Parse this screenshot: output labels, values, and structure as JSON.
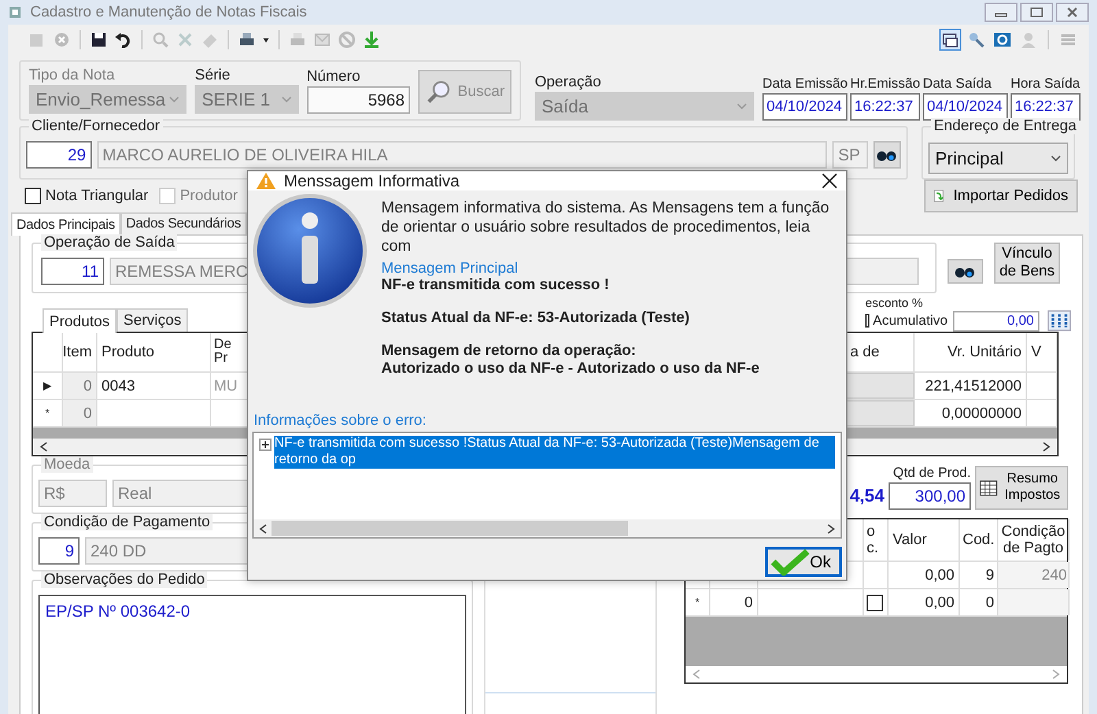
{
  "window": {
    "title": "Cadastro e Manutenção de Notas Fiscais"
  },
  "nota": {
    "tipo": {
      "label": "Tipo da Nota",
      "value": "Envio_Remessa",
      "disabled": true
    },
    "serie": {
      "label": "Série",
      "value": "SERIE 1",
      "disabled": true
    },
    "numero": {
      "label": "Número",
      "value": "5968"
    },
    "buscar": {
      "label": "Buscar",
      "disabled": true
    },
    "operacao": {
      "label": "Operação",
      "value": "Saída",
      "disabled": true
    }
  },
  "datas": [
    {
      "label": "Data Emissão",
      "value": "04/10/2024"
    },
    {
      "label": "Hr.Emissão",
      "value": "16:22:37"
    },
    {
      "label": "Data Saída",
      "value": "04/10/2024"
    },
    {
      "label": "Hora Saída",
      "value": "16:22:37"
    }
  ],
  "cliente": {
    "label": "Cliente/Fornecedor",
    "code": "29",
    "name": "MARCO AURELIO DE OLIVEIRA HILA",
    "uf": "SP"
  },
  "endereco": {
    "label": "Endereço de Entrega",
    "value": "Principal"
  },
  "options": [
    {
      "label": "Nota Triangular",
      "checked": false,
      "disabled": false
    },
    {
      "label": "Produtor",
      "checked": false,
      "disabled": true
    }
  ],
  "import_button": "Importar Pedidos",
  "tabs": [
    {
      "label": "Dados Principais",
      "selected": true
    },
    {
      "label": "Dados Secundários",
      "selected": false
    }
  ],
  "operacao_saida": {
    "label": "Operação de Saída",
    "code": "11",
    "name": "REMESSA MERC"
  },
  "vinculo_button": "Vínculo de Bens",
  "desconto": {
    "label": "esconto %",
    "acumulativo": {
      "label": "Acumulativo",
      "checked": false
    },
    "value": "0,00"
  },
  "item_tabs": [
    {
      "label": "Produtos",
      "selected": true
    },
    {
      "label": "Serviços",
      "selected": false
    }
  ],
  "products": {
    "columns": [
      "Item",
      "Produto",
      "De Pr",
      "a de",
      "Vr. Unitário",
      "V"
    ],
    "rows": [
      {
        "marker": "▶",
        "cells": [
          "0",
          "0043",
          "MU",
          "",
          "221,41512000",
          ""
        ]
      },
      {
        "marker": "*",
        "cells": [
          "0",
          "",
          "",
          "",
          "0,00000000",
          ""
        ]
      }
    ]
  },
  "moeda": {
    "label": "Moeda",
    "code": "R$",
    "name": "Real"
  },
  "total": "4,54",
  "qtd": {
    "label": "Qtd de Prod.",
    "value": "300,00"
  },
  "resumo_button": "Resumo Impostos",
  "condicao": {
    "label": "Condição de Pagamento",
    "code": "9",
    "name": "240 DD"
  },
  "observacoes": {
    "label": "Observações do Pedido",
    "text": "EP/SP Nº 003642-0"
  },
  "payments": {
    "columns": [
      "o c.",
      "Valor",
      "Cod.",
      "Condição de Pagto"
    ],
    "rows": [
      {
        "marker": "",
        "a": "",
        "valor": "0,00",
        "cod": "9",
        "cond": "240"
      },
      {
        "marker": "*",
        "a": "0",
        "checked": false,
        "valor": "0,00",
        "cod": "0",
        "cond": ""
      }
    ]
  },
  "dialog": {
    "title": "Menssagem Informativa",
    "intro": "Mensagem informativa do sistema. As Mensagens tem a função de orientar o usuário sobre resultados de procedimentos, leia com",
    "section": "Mensagem Principal",
    "blocks": [
      [
        "NF-e transmitida com sucesso !"
      ],
      [
        "Status Atual da NF-e: 53-Autorizada (Teste)"
      ],
      [
        "Mensagem de retorno da operação:",
        "Autorizado o uso da NF-e - Autorizado o uso da NF-e"
      ]
    ],
    "error_label": "Informações sobre o erro:",
    "tree": [
      {
        "text": "NF-e transmitida com sucesso !Status Atual da NF-e: 53-Autorizada (Teste)Mensagem de retorno da op",
        "expanded": false,
        "selected": true
      }
    ],
    "ok": "Ok"
  }
}
